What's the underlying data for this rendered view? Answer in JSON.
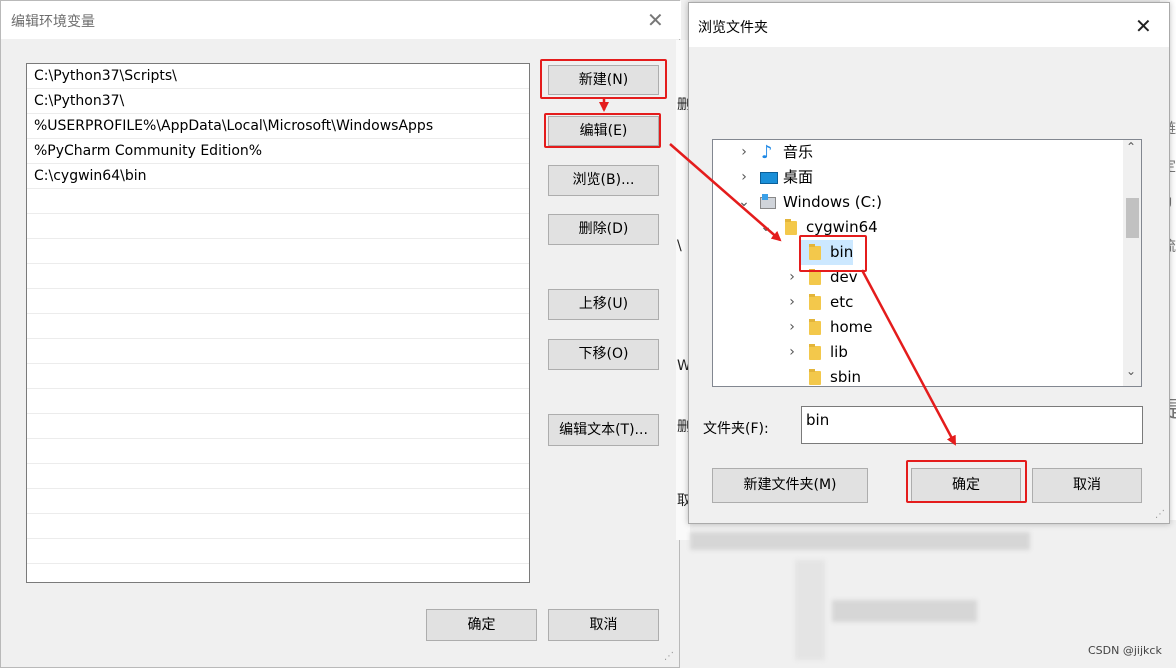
{
  "env_dialog": {
    "title": "编辑环境变量",
    "close_glyph": "✕",
    "paths": [
      "C:\\Python37\\Scripts\\",
      "C:\\Python37\\",
      "%USERPROFILE%\\AppData\\Local\\Microsoft\\WindowsApps",
      "%PyCharm Community Edition%",
      "C:\\cygwin64\\bin",
      "",
      "",
      "",
      "",
      "",
      "",
      "",
      "",
      "",
      "",
      "",
      "",
      "",
      "",
      "",
      ""
    ],
    "buttons": {
      "new": "新建(N)",
      "edit": "编辑(E)",
      "browse": "浏览(B)...",
      "delete": "删除(D)",
      "move_up": "上移(U)",
      "move_down": "下移(O)",
      "edit_text": "编辑文本(T)...",
      "ok": "确定",
      "cancel": "取消"
    }
  },
  "background_window": {
    "fragments": [
      "删",
      "\\",
      "W",
      "删",
      "取"
    ],
    "right_fragments": [
      "链",
      "定",
      "U",
      "流",
      "是"
    ]
  },
  "browse_dialog": {
    "title": "浏览文件夹",
    "close_glyph": "✕",
    "tree": [
      {
        "label": "音乐",
        "chevron": "›"
      },
      {
        "label": "桌面",
        "chevron": "›"
      },
      {
        "label": "Windows (C:)",
        "chevron": "⌄"
      },
      {
        "label": "cygwin64",
        "chevron": "⌄"
      },
      {
        "label": "bin",
        "chevron": ""
      },
      {
        "label": "dev",
        "chevron": "›"
      },
      {
        "label": "etc",
        "chevron": "›"
      },
      {
        "label": "home",
        "chevron": "›"
      },
      {
        "label": "lib",
        "chevron": "›"
      },
      {
        "label": "sbin",
        "chevron": ""
      }
    ],
    "scroll_up": "⌃",
    "scroll_down": "⌄",
    "folder_label": "文件夹(F):",
    "folder_value": "bin",
    "buttons": {
      "new_folder": "新建文件夹(M)",
      "ok": "确定",
      "cancel": "取消"
    }
  },
  "watermark": "CSDN @jijkck",
  "colors": {
    "highlight_red": "#e41c1c",
    "selection": "#cce8ff",
    "button_bg": "#e1e1e1"
  }
}
